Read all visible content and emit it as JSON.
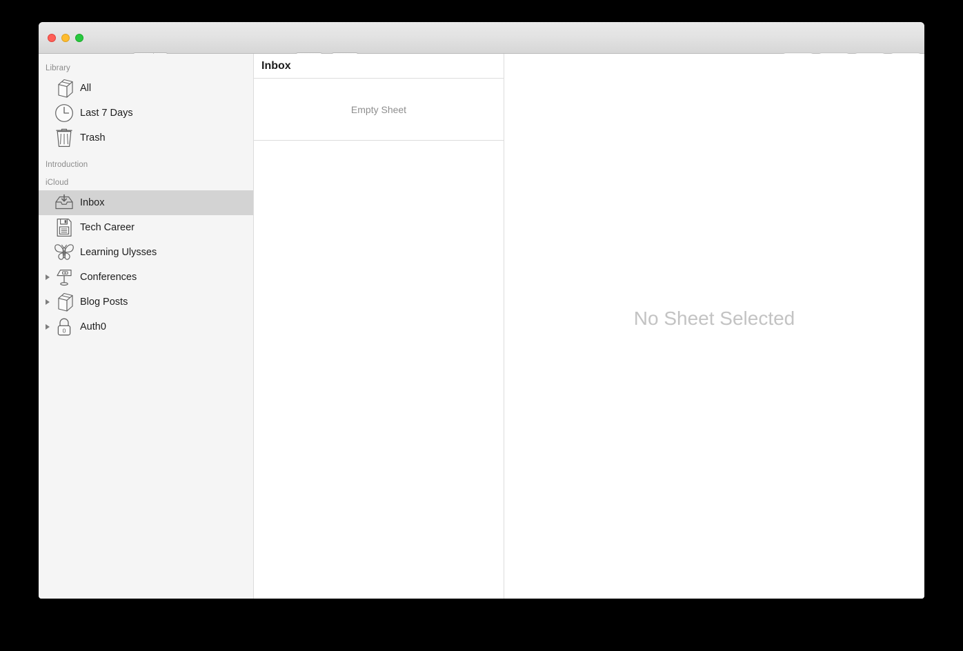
{
  "window": {
    "traffic_lights": [
      {
        "name": "close",
        "color": "#ff5f57"
      },
      {
        "name": "minimize",
        "color": "#febc2e"
      },
      {
        "name": "zoom",
        "color": "#28c840"
      }
    ]
  },
  "toolbar": {
    "sidebar_toggle": {
      "icon": "sidebar-toggle-icon",
      "dropdown_icon": "chevron-down-icon"
    },
    "left_buttons": [
      {
        "name": "search-button",
        "icon": "search-icon"
      },
      {
        "name": "compose-button",
        "icon": "compose-icon"
      }
    ],
    "right_buttons": [
      {
        "name": "share-button",
        "icon": "share-icon",
        "enabled": false
      },
      {
        "name": "statistics-button",
        "icon": "gauge-icon",
        "enabled": false
      },
      {
        "name": "list-button",
        "icon": "list-icon",
        "enabled": false
      },
      {
        "name": "format-button",
        "icon": "format-a-icon",
        "enabled": false
      },
      {
        "name": "attachments-button",
        "icon": "paperclip-icon",
        "enabled": false
      }
    ]
  },
  "sidebar": {
    "sections": [
      {
        "label": "Library",
        "items": [
          {
            "label": "All",
            "icon": "book-icon",
            "disclosure": false,
            "selected": false
          },
          {
            "label": "Last 7 Days",
            "icon": "clock-icon",
            "disclosure": false,
            "selected": false
          },
          {
            "label": "Trash",
            "icon": "trash-icon",
            "disclosure": false,
            "selected": false
          }
        ]
      },
      {
        "label": "Introduction",
        "items": []
      },
      {
        "label": "iCloud",
        "items": [
          {
            "label": "Inbox",
            "icon": "inbox-icon",
            "disclosure": false,
            "selected": true
          },
          {
            "label": "Tech Career",
            "icon": "document-icon",
            "disclosure": false,
            "selected": false
          },
          {
            "label": "Learning Ulysses",
            "icon": "butterfly-icon",
            "disclosure": false,
            "selected": false
          },
          {
            "label": "Conferences",
            "icon": "podium-icon",
            "disclosure": true,
            "selected": false
          },
          {
            "label": "Blog Posts",
            "icon": "book-icon",
            "disclosure": true,
            "selected": false
          },
          {
            "label": "Auth0",
            "icon": "lock-icon",
            "disclosure": true,
            "selected": false
          }
        ]
      }
    ]
  },
  "list_pane": {
    "header_title": "Inbox",
    "items": [
      {
        "label": "Empty Sheet"
      }
    ]
  },
  "detail_pane": {
    "placeholder": "No Sheet Selected"
  },
  "colors": {
    "window_background": "#f6f6f6",
    "sidebar_background": "#f5f5f5",
    "selection": "#d3d3d3",
    "content_background": "#ffffff",
    "divider": "#dcdcdc",
    "text_primary": "#1d1d1d",
    "text_secondary": "#8a8a8a",
    "placeholder_text": "#c3c3c3"
  }
}
